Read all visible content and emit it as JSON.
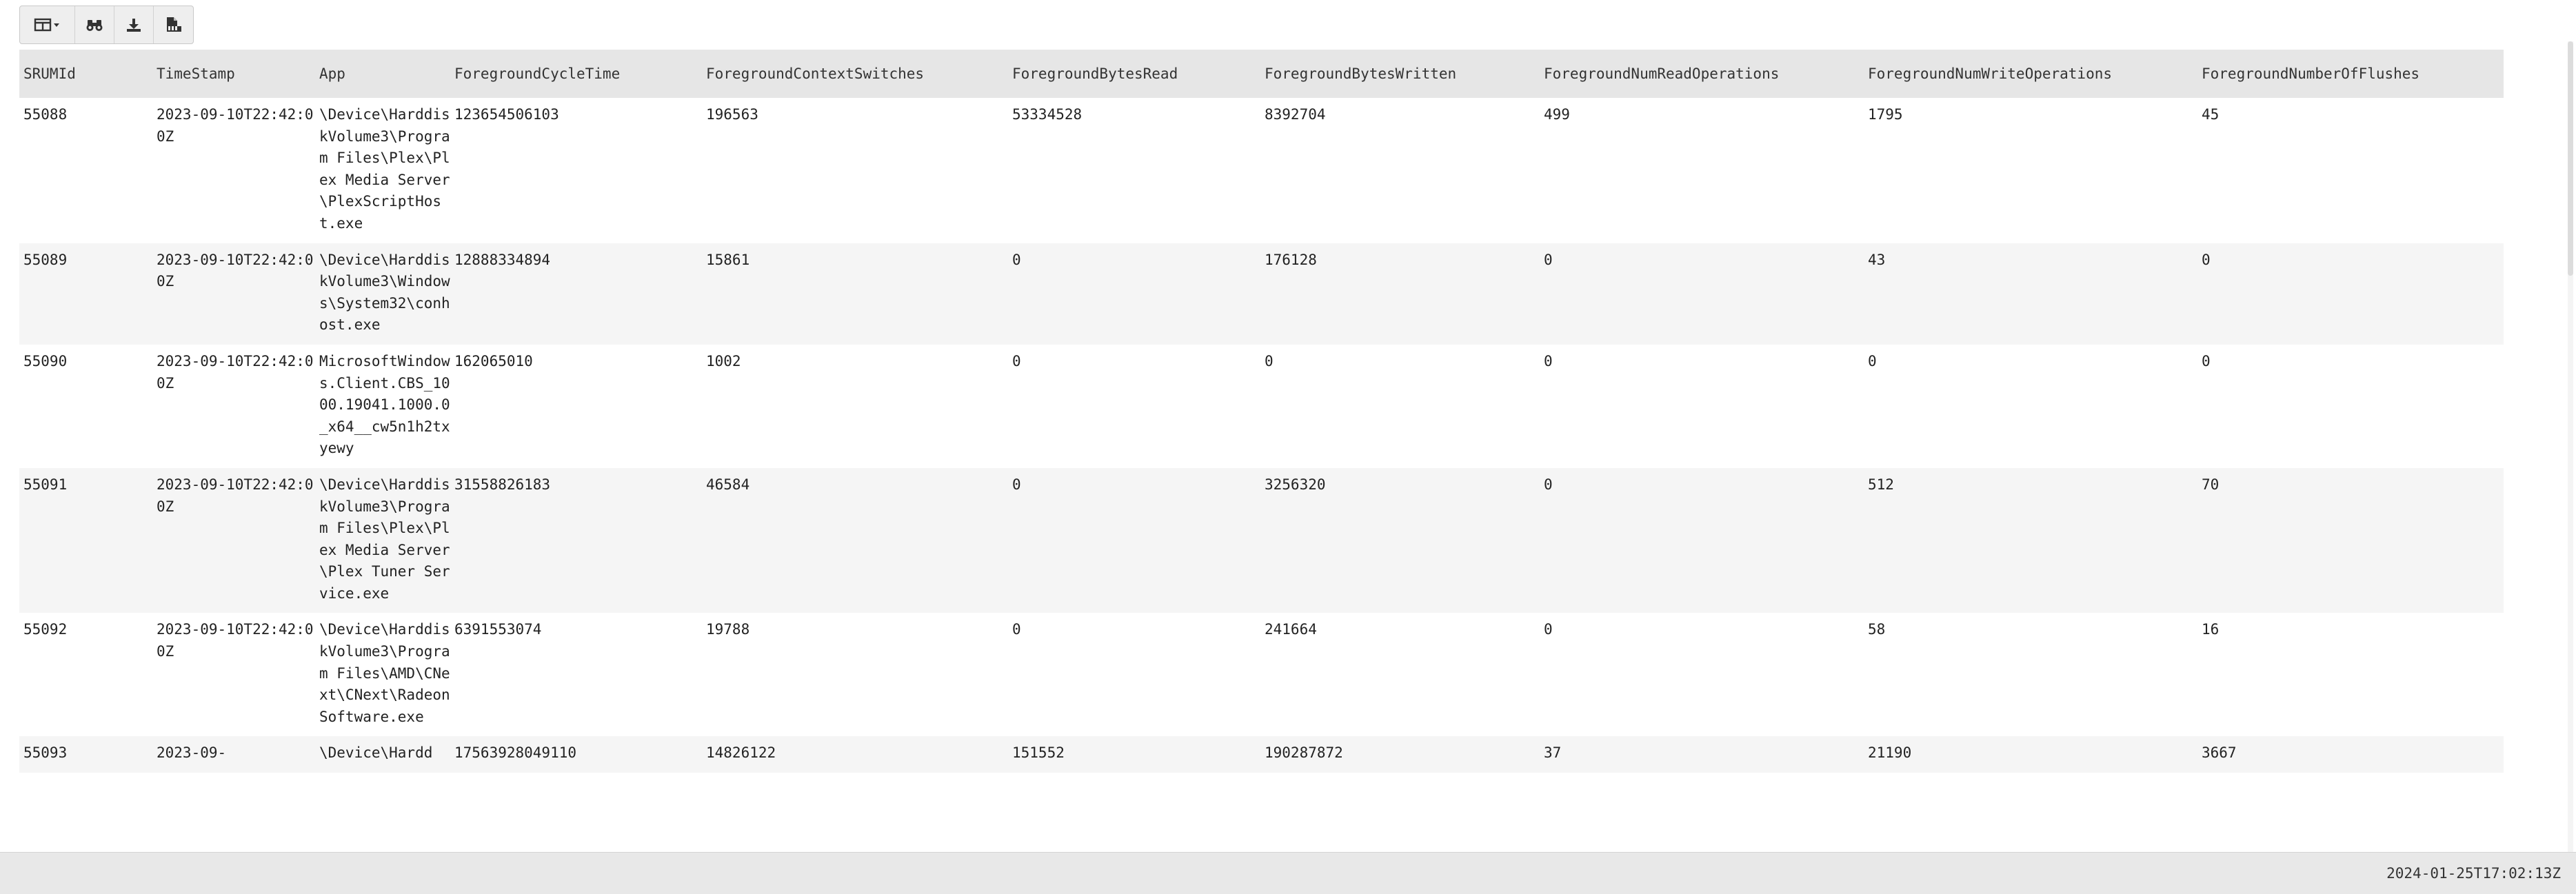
{
  "toolbar": {
    "buttons": [
      {
        "name": "columns-toggle-button",
        "icon": "table-columns-icon"
      },
      {
        "name": "find-button",
        "icon": "binoculars-icon"
      },
      {
        "name": "download-button",
        "icon": "download-icon"
      },
      {
        "name": "export-csv-button",
        "icon": "file-csv-icon"
      }
    ]
  },
  "table": {
    "headers": [
      "SRUMId",
      "TimeStamp",
      "App",
      "ForegroundCycleTime",
      "ForegroundContextSwitches",
      "ForegroundBytesRead",
      "ForegroundBytesWritten",
      "ForegroundNumReadOperations",
      "ForegroundNumWriteOperations",
      "ForegroundNumberOfFlushes"
    ],
    "rows": [
      [
        "55088",
        "2023-09-10T22:42:00Z",
        "\\Device\\HarddiskVolume3\\Program Files\\Plex\\Plex Media Server\\PlexScriptHost.exe",
        "123654506103",
        "196563",
        "53334528",
        "8392704",
        "499",
        "1795",
        "45"
      ],
      [
        "55089",
        "2023-09-10T22:42:00Z",
        "\\Device\\HarddiskVolume3\\Windows\\System32\\conhost.exe",
        "12888334894",
        "15861",
        "0",
        "176128",
        "0",
        "43",
        "0"
      ],
      [
        "55090",
        "2023-09-10T22:42:00Z",
        "MicrosoftWindows.Client.CBS_1000.19041.1000.0_x64__cw5n1h2txyewy",
        "162065010",
        "1002",
        "0",
        "0",
        "0",
        "0",
        "0"
      ],
      [
        "55091",
        "2023-09-10T22:42:00Z",
        "\\Device\\HarddiskVolume3\\Program Files\\Plex\\Plex Media Server\\Plex Tuner Service.exe",
        "31558826183",
        "46584",
        "0",
        "3256320",
        "0",
        "512",
        "70"
      ],
      [
        "55092",
        "2023-09-10T22:42:00Z",
        "\\Device\\HarddiskVolume3\\Program Files\\AMD\\CNext\\CNext\\RadeonSoftware.exe",
        "6391553074",
        "19788",
        "0",
        "241664",
        "0",
        "58",
        "16"
      ],
      [
        "55093",
        "2023-09-",
        "\\Device\\Hardd",
        "17563928049110",
        "14826122",
        "151552",
        "190287872",
        "37",
        "21190",
        "3667"
      ]
    ]
  },
  "status": {
    "timestamp": "2024-01-25T17:02:13Z"
  }
}
